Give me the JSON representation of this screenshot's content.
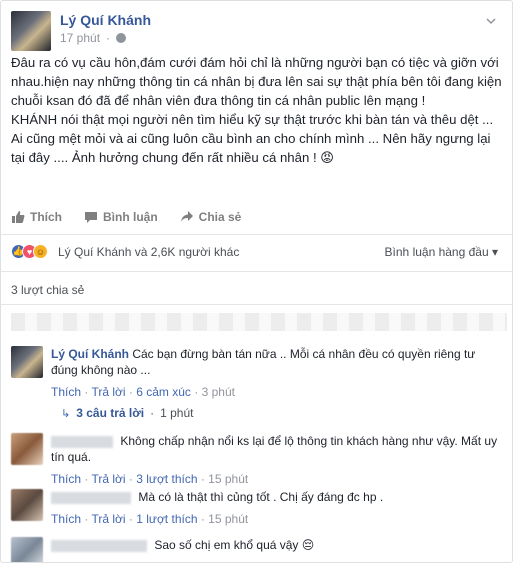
{
  "post": {
    "author": "Lý Quí Khánh",
    "time": "17 phút",
    "paragraph1": "Đâu ra có vụ cầu hôn,đám cưới đám hỏi chỉ là những người bạn có tiệc và giỡn với nhau.hiện nay những thông tin cá nhân bị đưa lên sai sự thật phía bên tôi đang kiện chuỗi ksan đó đã để nhân viên đưa thông tin cá nhân public lên mạng !",
    "paragraph2": "KHÁNH nói thật mọi người nên tìm hiểu kỹ sự thật trước khi bàn tán và thêu dệt ... Ai cũng mệt mỏi và ai cũng luôn cầu bình an cho chính mình ... Nên hãy ngưng lại tại đây .... Ảnh hưởng chung đến rất nhiều cá nhân ! 😡"
  },
  "actions": {
    "like": "Thích",
    "comment": "Bình luận",
    "share": "Chia sẻ"
  },
  "reactions": {
    "summary": "Lý Quí Khánh và 2,6K người khác",
    "sort": "Bình luận hàng đầu ▾"
  },
  "shares": "3 lượt chia sẻ",
  "comments": [
    {
      "name": "Lý Quí Khánh",
      "text1": "Các bạn đừng bàn tán nữa .. Mỗi cá nhân đều có quyền riêng tư",
      "text2": "đúng không nào ...",
      "like": "Thích",
      "reply": "Trả lời",
      "stat": "6 cảm xúc",
      "time": "3 phút",
      "replies": "3 câu trả lời",
      "replies_time": "1 phút"
    },
    {
      "text1": "Không chấp nhận nổi ks lại để lộ thông tin khách hàng như vậy. Mất uy",
      "text2": "tín quá.",
      "like": "Thích",
      "reply": "Trả lời",
      "stat": "3 lượt thích",
      "time": "15 phút"
    },
    {
      "text1": "Mà có là thật thì củng tốt . Chị ấy đáng đc hp .",
      "like": "Thích",
      "reply": "Trả lời",
      "stat": "1 lượt thích",
      "time": "15 phút"
    },
    {
      "text1": "Sao số chị em khổ quá vậy 😔"
    }
  ]
}
